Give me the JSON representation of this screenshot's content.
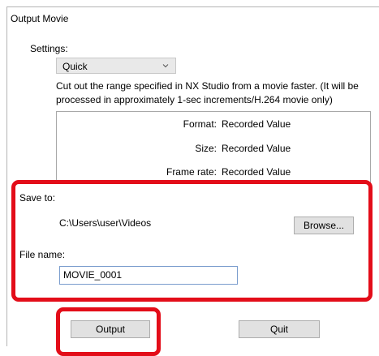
{
  "window": {
    "title": "Output Movie"
  },
  "settings": {
    "label": "Settings:",
    "selected": "Quick",
    "description": "Cut out the range specified in NX Studio from a movie faster. (It will be processed in approximately 1-sec increments/H.264 movie only)"
  },
  "info": {
    "format_label": "Format:",
    "format_value": "Recorded Value",
    "size_label": "Size:",
    "size_value": "Recorded Value",
    "framerate_label": "Frame rate:",
    "framerate_value": "Recorded Value"
  },
  "save": {
    "label": "Save to:",
    "path": "C:\\Users\\user\\Videos",
    "browse_label": "Browse..."
  },
  "file": {
    "label": "File name:",
    "value": "MOVIE_0001"
  },
  "actions": {
    "output_label": "Output",
    "quit_label": "Quit"
  },
  "colors": {
    "highlight": "#e30d19",
    "button_bg": "#e1e1e1",
    "input_border": "#7a9ccd"
  },
  "icons": {
    "dropdown": "chevron-down-icon"
  }
}
